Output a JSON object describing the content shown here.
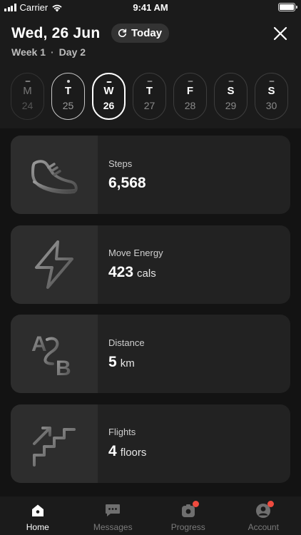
{
  "status_bar": {
    "carrier": "Carrier",
    "time": "9:41 AM",
    "battery_level": 1.0
  },
  "header": {
    "title": "Wed, 26 Jun",
    "today_label": "Today",
    "week_label": "Week 1",
    "separator": "·",
    "day_label": "Day 2"
  },
  "days": [
    {
      "letter": "M",
      "num": "24",
      "state": "past"
    },
    {
      "letter": "T",
      "num": "25",
      "state": "completed"
    },
    {
      "letter": "W",
      "num": "26",
      "state": "selected"
    },
    {
      "letter": "T",
      "num": "27",
      "state": "future"
    },
    {
      "letter": "F",
      "num": "28",
      "state": "future"
    },
    {
      "letter": "S",
      "num": "29",
      "state": "future"
    },
    {
      "letter": "S",
      "num": "30",
      "state": "future"
    }
  ],
  "cards": [
    {
      "label": "Steps",
      "value": "6,568",
      "unit": "",
      "icon": "sneaker-icon"
    },
    {
      "label": "Move Energy",
      "value": "423",
      "unit": "cals",
      "icon": "lightning-icon"
    },
    {
      "label": "Distance",
      "value": "5",
      "unit": "km",
      "icon": "a-to-b-icon"
    },
    {
      "label": "Flights",
      "value": "4",
      "unit": "floors",
      "icon": "stairs-icon"
    }
  ],
  "tabs": [
    {
      "label": "Home",
      "icon": "home-icon",
      "active": true,
      "badge": false
    },
    {
      "label": "Messages",
      "icon": "messages-icon",
      "active": false,
      "badge": false
    },
    {
      "label": "Progress",
      "icon": "progress-icon",
      "active": false,
      "badge": true
    },
    {
      "label": "Account",
      "icon": "account-icon",
      "active": false,
      "badge": true
    }
  ],
  "colors": {
    "background": "#131313",
    "header_bg": "#1b1b1b",
    "card_bg": "#222222",
    "badge": "#ef4b3f"
  }
}
